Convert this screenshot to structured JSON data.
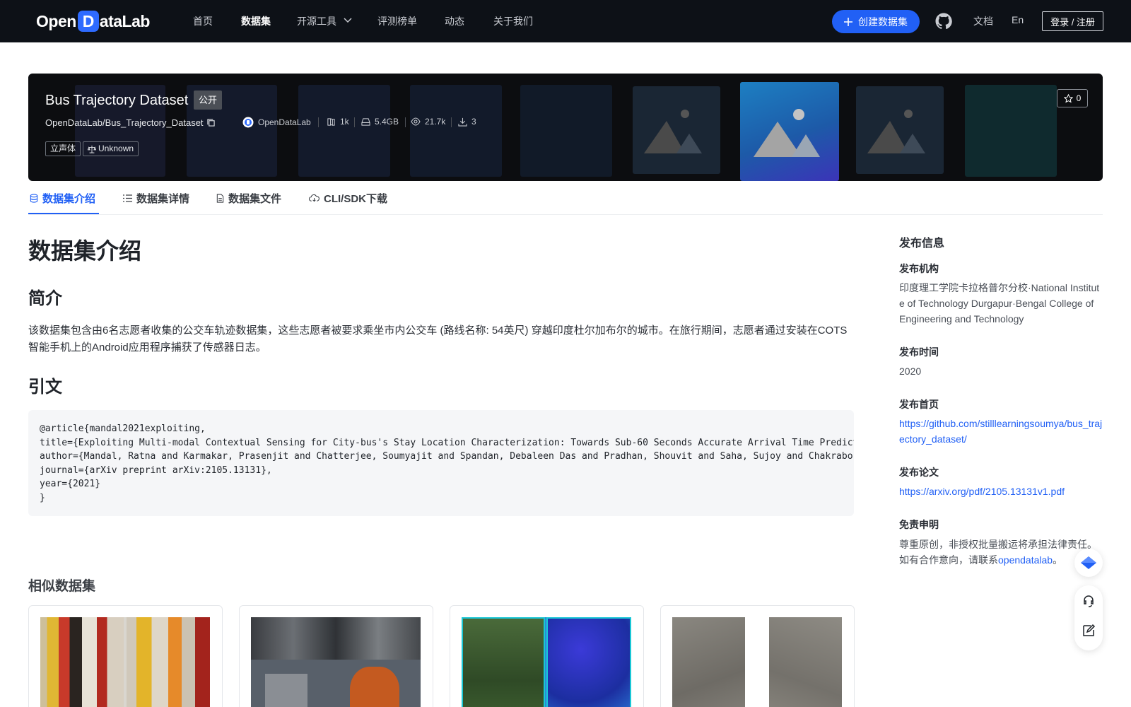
{
  "nav": {
    "logo_prefix": "Open",
    "logo_d": "D",
    "logo_suffix": "ataLab",
    "items": [
      "首页",
      "数据集",
      "开源工具",
      "评测榜单",
      "动态",
      "关于我们"
    ],
    "active_index": 1,
    "create_label": "创建数据集",
    "docs_label": "文档",
    "lang_label": "En",
    "login_label": "登录 / 注册"
  },
  "dataset": {
    "title": "Bus Trajectory Dataset",
    "visibility": "公开",
    "path": "OpenDataLab/Bus_Trajectory_Dataset",
    "publisher": "OpenDataLab",
    "size_files": "1k",
    "storage": "5.4GB",
    "views": "21.7k",
    "downloads": "3",
    "tags": [
      "立声体"
    ],
    "license": "Unknown",
    "stars": "0"
  },
  "tabs": [
    {
      "label": "数据集介绍",
      "icon": "database-icon"
    },
    {
      "label": "数据集详情",
      "icon": "list-icon"
    },
    {
      "label": "数据集文件",
      "icon": "file-icon"
    },
    {
      "label": "CLI/SDK下载",
      "icon": "cloud-icon"
    }
  ],
  "main": {
    "heading": "数据集介绍",
    "intro_heading": "简介",
    "intro_text": "该数据集包含由6名志愿者收集的公交车轨迹数据集，这些志愿者被要求乘坐市内公交车 (路线名称: 54英尺) 穿越印度杜尔加布尔的城市。在旅行期间，志愿者通过安装在COTS智能手机上的Android应用程序捕获了传感器日志。",
    "citation_heading": "引文",
    "citation": "@article{mandal2021exploiting,\ntitle={Exploiting Multi-modal Contextual Sensing for City-bus's Stay Location Characterization: Towards Sub-60 Seconds Accurate Arrival Time Prediction},\nauthor={Mandal, Ratna and Karmakar, Prasenjit and Chatterjee, Soumyajit and Spandan, Debaleen Das and Pradhan, Shouvit and Saha, Sujoy and Chakraborty, Sandip and Nandi, Subrata},\njournal={arXiv preprint arXiv:2105.13131},\nyear={2021}\n}",
    "similar_heading": "相似数据集"
  },
  "sidebar": {
    "title": "发布信息",
    "org_label": "发布机构",
    "org_value": "印度理工学院卡拉格普尔分校·National Institute of Technology Durgapur·Bengal College of Engineering and Technology",
    "date_label": "发布时间",
    "date_value": "2020",
    "homepage_label": "发布首页",
    "homepage_value": "https://github.com/stilllearningsoumya/bus_trajectory_dataset/",
    "paper_label": "发布论文",
    "paper_value": "https://arxiv.org/pdf/2105.13131v1.pdf",
    "disclaimer_label": "免责申明",
    "disclaimer_line1": "尊重原创，非授权批量搬运将承担法律责任。",
    "disclaimer_line2_prefix": "如有合作意向，请联系",
    "disclaimer_link": "opendatalab",
    "disclaimer_suffix": "。"
  }
}
